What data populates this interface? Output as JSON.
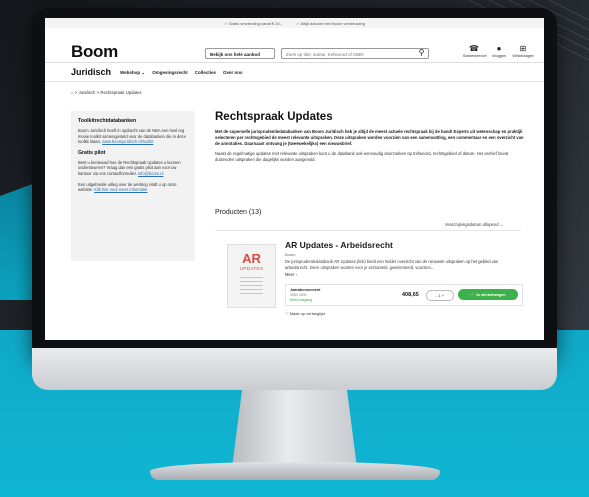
{
  "topbar": {
    "items": [
      "✓ Gratis verzending vanaf € 20,-",
      "✓ Altijd actueel met Boom vernieuwing"
    ]
  },
  "header": {
    "logo": "Boom",
    "scope_select": "Bekijk ons hele aanbod",
    "search_placeholder": "Zoek op titel, auteur, trefwoord of ISBN",
    "icons": [
      {
        "label": "Klantenservice",
        "icon": "headset-icon"
      },
      {
        "label": "Inloggen",
        "icon": "user-icon"
      },
      {
        "label": "Winkelwagen",
        "icon": "cart-icon"
      }
    ]
  },
  "nav": {
    "brand": "Juridisch",
    "items": [
      "Webshop ⌄",
      "Omgevingsrecht",
      "Collecties",
      "Over ons"
    ]
  },
  "breadcrumb": "⌂ > Juridisch > Rechtspraak Updates",
  "sidebar": {
    "title": "Toolkitrechtdatabanken",
    "p1": "Boom Juridisch heeft in opdracht van de NBA een heel erg mooie toolkit samengesteld voor de databanken die in deze toolkit staan.",
    "p1_link": "www.boomjuridisch.nl/toolkit",
    "gratis_title": "Gratis pilot",
    "p2": "Bent u benieuwd hoe de Rechtspraak Updates u kunnen ondersteunen? Vraag dan een gratis pilot aan voor uw kantoor via ons contactformulier.",
    "p2_link": "info@boom.nl",
    "p3": "Een uitgebreide uitleg over de werking vindt u op onze website.",
    "p3_link": "Klik hier voor meer informatie"
  },
  "main": {
    "title": "Rechtspraak Updates",
    "intro": "Met de superselle jurisprudentiedatabanken van Boom Juridisch heb je altijd de meest actuele rechtspraak bij de hand! Experts uit wetenschap en praktijk selecteren per rechtsgebied de meest relevante uitspraken. Deze uitspraken worden voorzien van een samenvatting, een commentaar en een overzicht van de annotaties. Daarnaast ontvang je (tweewekelijks) een nieuwsbrief.",
    "para": "Naast de regelmatige updates met relevante uitspraken kunt u de databank ook eenvoudig doorzoeken op trefwoord, rechtsgebied of datum. Het archief bevat duizenden uitspraken die dagelijks worden aangevuld.",
    "products_label": "Producten (13)",
    "sort_label": "Verschijningsdatum aflopend ⌄"
  },
  "product": {
    "cover_big": "AR",
    "cover_small": "UPDATES",
    "title": "AR Updates - Arbeidsrecht",
    "brand": "Boom",
    "desc": "De jurisprudentiedatabank AR Updates (link) biedt een helder overzicht van de nieuwste uitspraken op het gebied van arbeidsrecht. Deze uitspraken worden voor je verzameld, geselecteerd, voorzien...",
    "more": "Meer ›",
    "offer_name": "Jaarabonnement",
    "offer_sub1": "ISBN 0000",
    "offer_sub2": "Direct toegang",
    "price": "408,65",
    "qty": "- 1 +",
    "cart_label": "🛒 In winkelwagen",
    "compare": "♡ Maak op verlanglijst"
  }
}
